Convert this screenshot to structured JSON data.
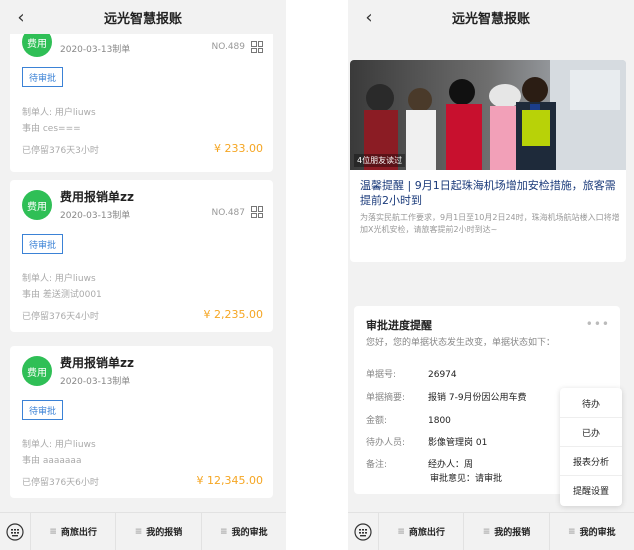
{
  "app_title": "远光智慧报账",
  "back_glyph": "‹",
  "list": {
    "cards": [
      {
        "badge": "费用",
        "title": "",
        "date": "2020-03-13制单",
        "no": "NO.489",
        "status": "待审批",
        "creator": "制单人: 用户liuws",
        "reason": "事由 ces===",
        "stay": "已停留376天3小时",
        "amount": "¥ 233.00"
      },
      {
        "badge": "费用",
        "title": "费用报销单zz",
        "date": "2020-03-13制单",
        "no": "NO.487",
        "status": "待审批",
        "creator": "制单人: 用户liuws",
        "reason": "事由 差送测试0001",
        "stay": "已停留376天4小时",
        "amount": "¥ 2,235.00"
      },
      {
        "badge": "费用",
        "title": "费用报销单zz",
        "date": "2020-03-13制单",
        "no": "",
        "status": "待审批",
        "creator": "制单人: 用户liuws",
        "reason": "事由 aaaaaaa",
        "stay": "已停留376天6小时",
        "amount": "¥ 12,345.00"
      }
    ]
  },
  "tabs": [
    {
      "label": "商旅出行"
    },
    {
      "label": "我的报销"
    },
    {
      "label": "我的审批"
    }
  ],
  "news": {
    "read_count": "4位朋友读过",
    "title": "温馨提醒 | 9月1日起珠海机场增加安检措施，旅客需提前2小时到",
    "desc": "为落实民航工作要求，9月1日至10月2日24时，珠海机场航站楼入口将增加X光机安检，请旅客提前2小时到达~"
  },
  "approval": {
    "title": "审批进度提醒",
    "more": "•••",
    "subtitle": "您好，您的单据状态发生改变，单据状态如下：",
    "rows": [
      {
        "k": "单据号:",
        "v": "26974"
      },
      {
        "k": "单据摘要:",
        "v": "报销 7-9月份因公用车费"
      },
      {
        "k": "金额:",
        "v": "1800"
      },
      {
        "k": "待办人员:",
        "v": "影像管理岗 01"
      },
      {
        "k": "备注:",
        "v": "经办人：周"
      }
    ],
    "note2": "审批意见：请审批"
  },
  "popup_menu": [
    {
      "label": "待办"
    },
    {
      "label": "已办"
    },
    {
      "label": "报表分析"
    },
    {
      "label": "提醒设置"
    }
  ],
  "colors": {
    "badge_green": "#2fbf56",
    "status_blue": "#3b82d6",
    "amount_orange": "#f5a623"
  }
}
